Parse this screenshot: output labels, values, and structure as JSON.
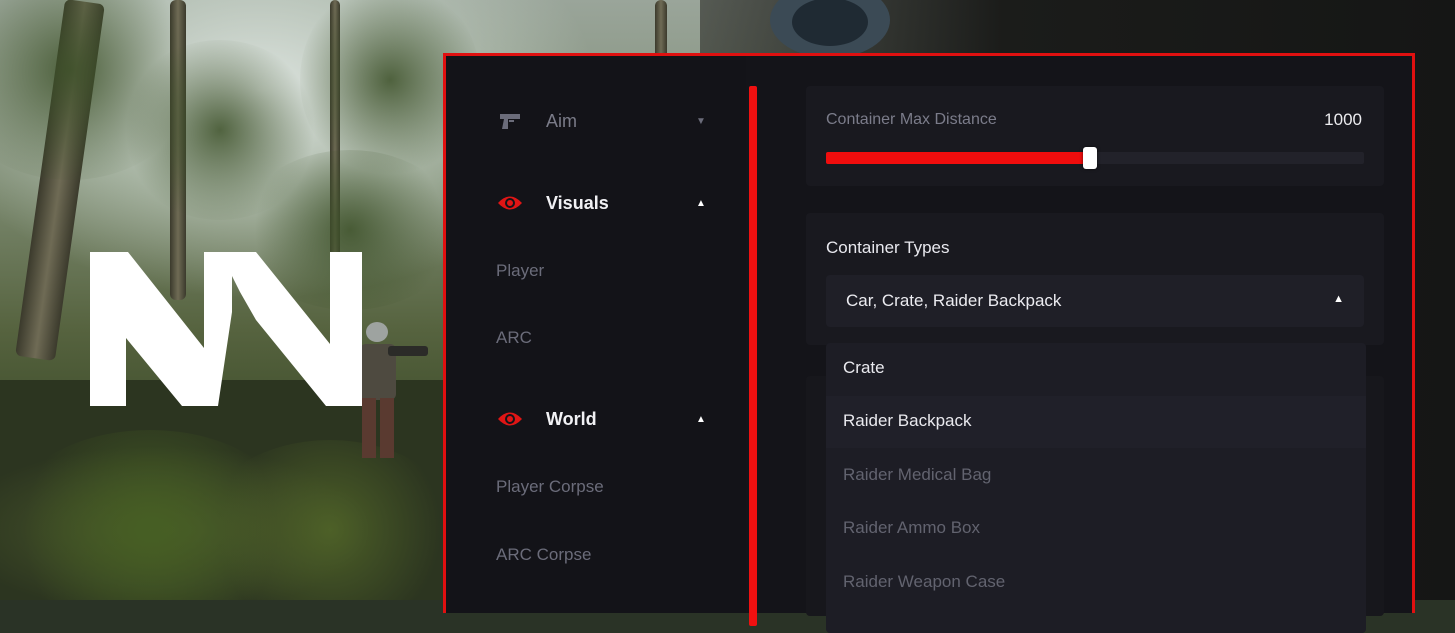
{
  "nav": {
    "aim": {
      "label": "Aim",
      "icon": "pistol-icon",
      "caret": "▼",
      "expanded": false
    },
    "visuals": {
      "label": "Visuals",
      "icon": "eye-icon",
      "caret": "▲",
      "expanded": true,
      "items": [
        {
          "label": "Player"
        },
        {
          "label": "ARC"
        }
      ]
    },
    "world": {
      "label": "World",
      "icon": "eye-icon",
      "caret": "▲",
      "expanded": true,
      "items": [
        {
          "label": "Player Corpse"
        },
        {
          "label": "ARC Corpse"
        }
      ]
    }
  },
  "settings": {
    "max_distance": {
      "label": "Container Max Distance",
      "value": "1000",
      "fill_fraction": 0.49
    },
    "container_types": {
      "label": "Container Types",
      "value": "Car, Crate, Raider Backpack",
      "caret": "▲",
      "options": [
        {
          "label": "Crate",
          "selected": true
        },
        {
          "label": "Raider Backpack",
          "selected": true
        },
        {
          "label": "Raider Medical Bag",
          "selected": false
        },
        {
          "label": "Raider Ammo Box",
          "selected": false
        },
        {
          "label": "Raider Weapon Case",
          "selected": false
        }
      ]
    }
  },
  "colors": {
    "accent": "#f00d0d",
    "panel_bg": "#141419",
    "muted_text": "#62636f"
  }
}
